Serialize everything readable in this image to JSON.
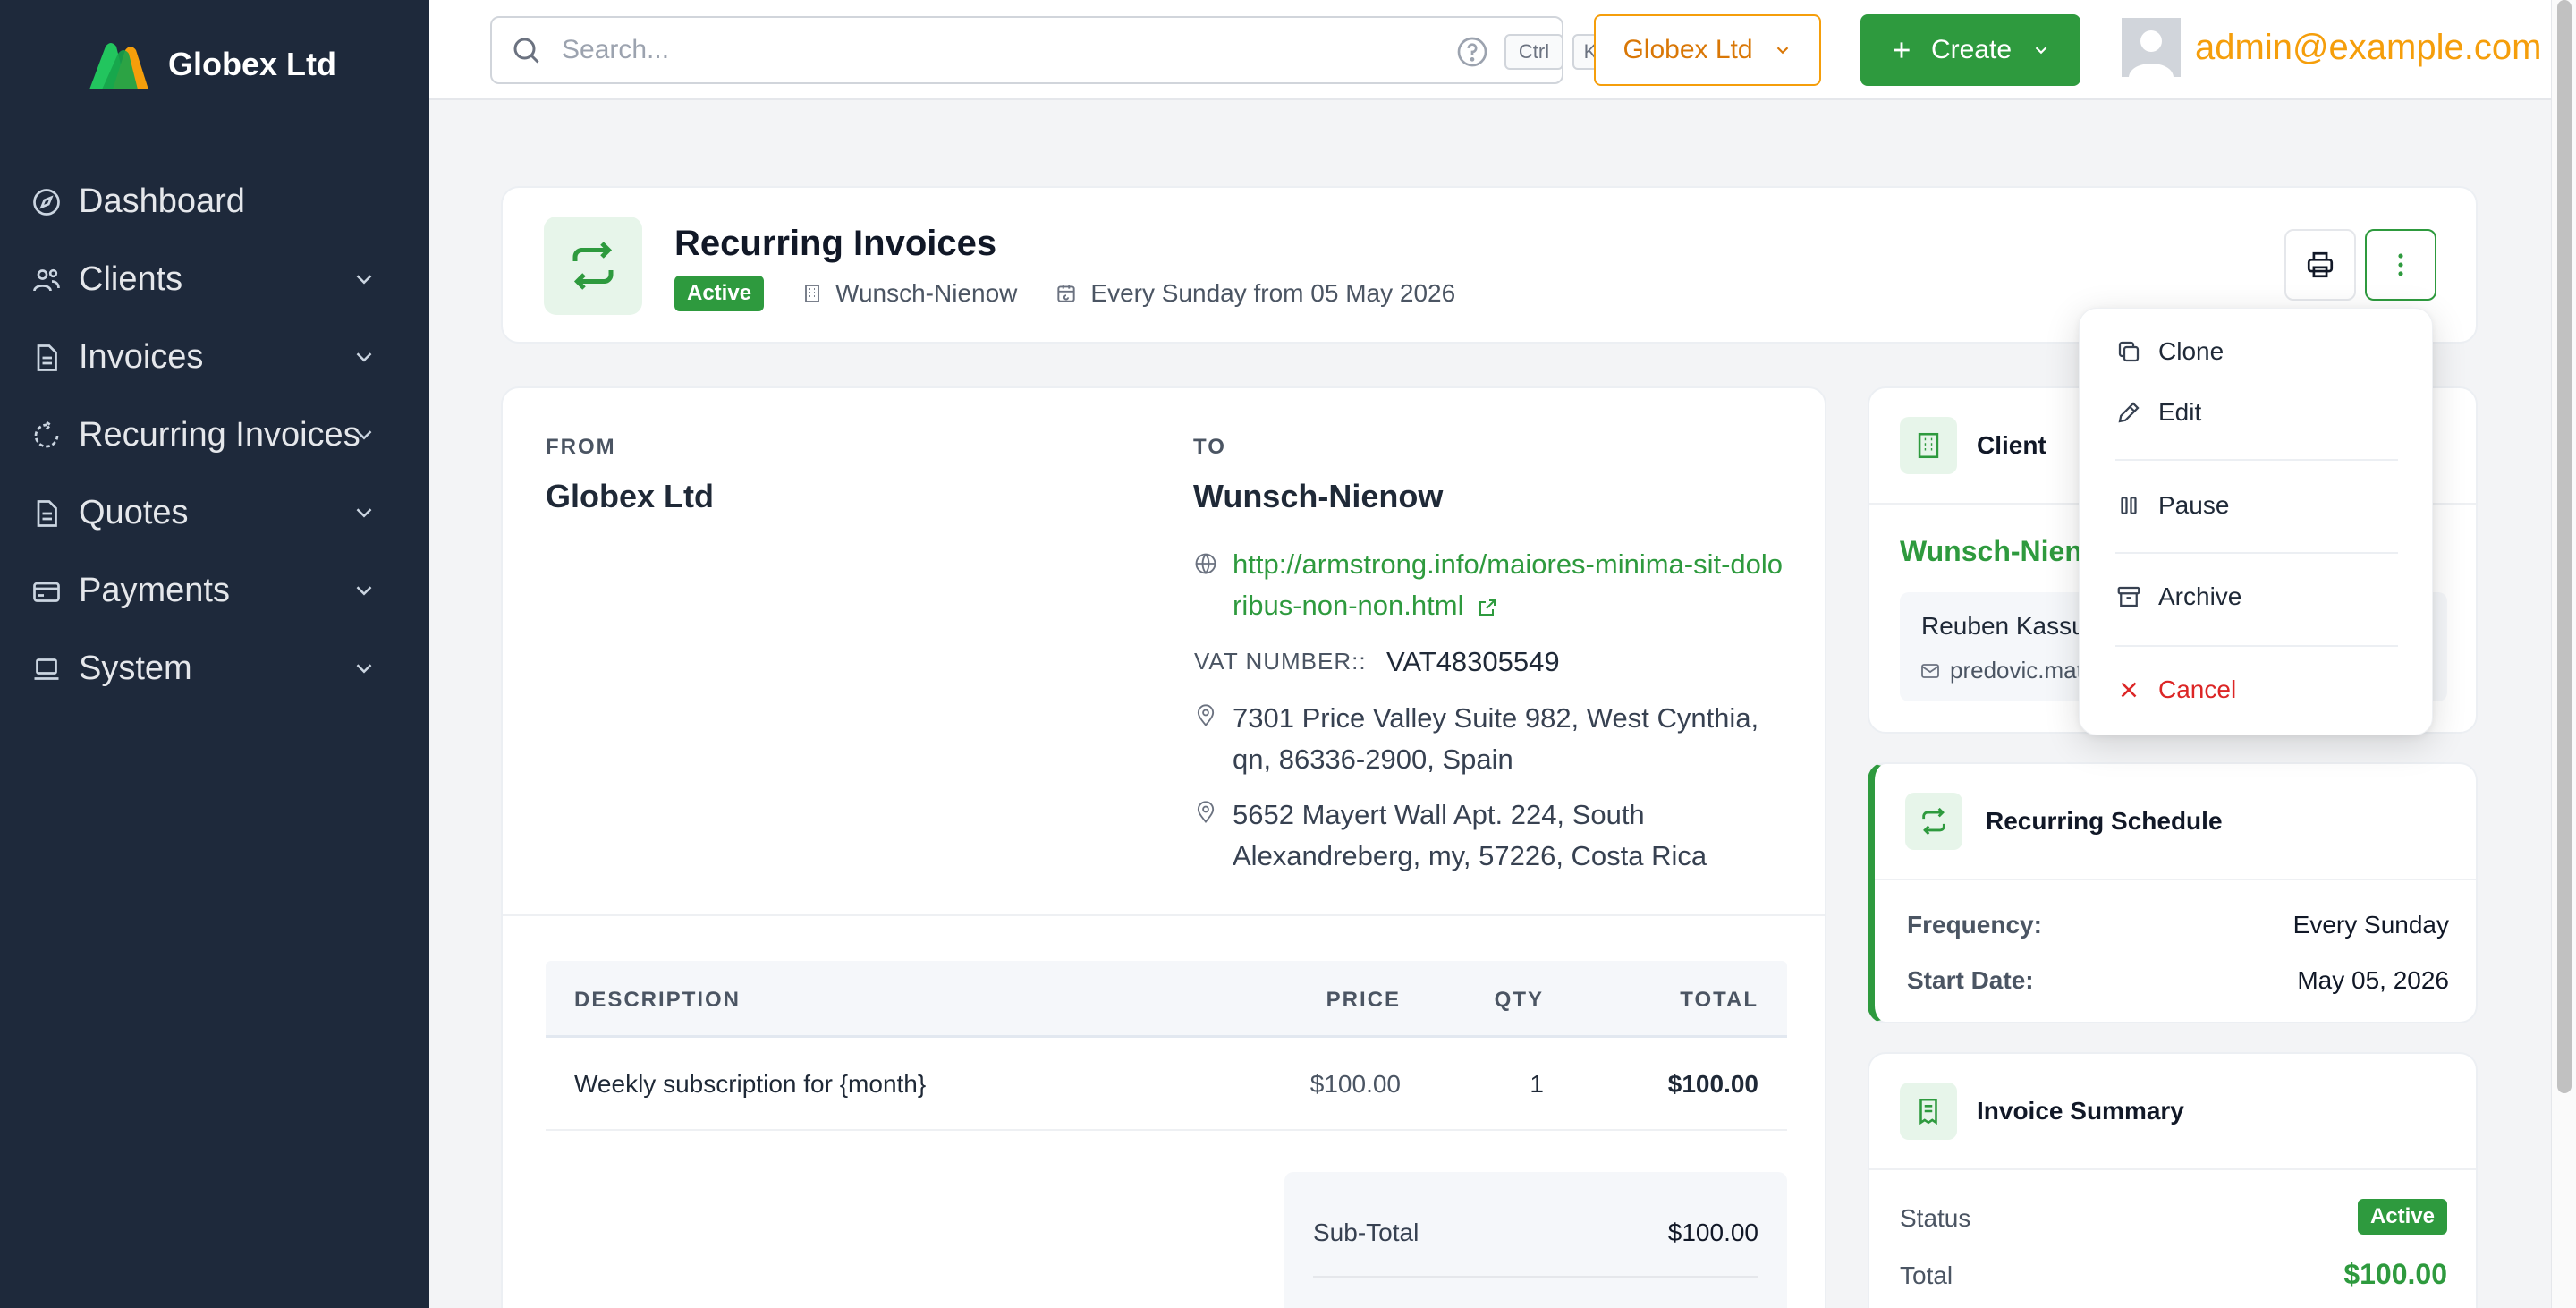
{
  "app": {
    "brand_name": "Globex Ltd",
    "accent": "#2e9a3e",
    "warning": "#f59e0b",
    "sidebar_bg": "#1e293b"
  },
  "sidebar": {
    "items": [
      {
        "label": "Dashboard",
        "icon": "compass-icon"
      },
      {
        "label": "Clients",
        "icon": "users-icon"
      },
      {
        "label": "Invoices",
        "icon": "document-icon"
      },
      {
        "label": "Recurring Invoices",
        "icon": "recurring-icon"
      },
      {
        "label": "Quotes",
        "icon": "document-icon"
      },
      {
        "label": "Payments",
        "icon": "credit-card-icon"
      },
      {
        "label": "System",
        "icon": "laptop-icon"
      }
    ]
  },
  "topbar": {
    "search_placeholder": "Search...",
    "kbd_ctrl": "Ctrl",
    "kbd_k": "K",
    "company_label": "Globex Ltd",
    "create_label": "Create",
    "user_email": "admin@example.com"
  },
  "header": {
    "title": "Recurring Invoices",
    "status": "Active",
    "client": "Wunsch-Nienow",
    "schedule": "Every Sunday from 05 May 2026"
  },
  "dropdown": {
    "clone": "Clone",
    "edit": "Edit",
    "pause": "Pause",
    "archive": "Archive",
    "cancel": "Cancel"
  },
  "invoice": {
    "from_label": "FROM",
    "from_name": "Globex Ltd",
    "to_label": "TO",
    "to_name": "Wunsch-Nienow",
    "website": "http://armstrong.info/maiores-minima-sit-doloribus-non-non.html",
    "vat_label": "VAT NUMBER::",
    "vat_value": "VAT48305549",
    "address_1": "7301 Price Valley Suite 982, West Cynthia, qn, 86336-2900, Spain",
    "address_2": "5652 Mayert Wall Apt. 224, South Alexandreberg, my, 57226, Costa Rica",
    "columns": [
      "DESCRIPTION",
      "PRICE",
      "QTY",
      "TOTAL"
    ],
    "items": [
      {
        "description": "Weekly subscription for {month}",
        "price": "$100.00",
        "qty": "1",
        "total": "$100.00"
      }
    ],
    "subtotal_label": "Sub-Total",
    "subtotal_value": "$100.00"
  },
  "client_card": {
    "title": "Client",
    "name": "Wunsch-Nienow",
    "contact_name": "Reuben Kassulke",
    "contact_email": "predovic.mathilde@example.org"
  },
  "schedule_card": {
    "title": "Recurring Schedule",
    "frequency_label": "Frequency:",
    "frequency_value": "Every Sunday",
    "start_label": "Start Date:",
    "start_value": "May 05, 2026"
  },
  "summary_card": {
    "title": "Invoice Summary",
    "status_label": "Status",
    "status_value": "Active",
    "total_label": "Total",
    "total_value": "$100.00"
  }
}
